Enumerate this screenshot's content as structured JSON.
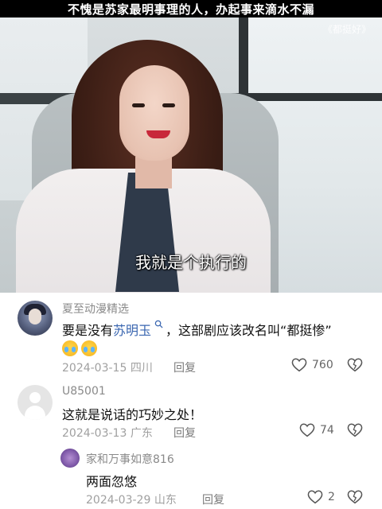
{
  "header": {
    "title": "不愧是苏家最明事理的人，办起事来滴水不漏"
  },
  "video": {
    "watermark": "《都挺好》",
    "subtitle": "我就是个执行的"
  },
  "comments": [
    {
      "username": "夏至动漫精选",
      "text_before": "要是没有",
      "link": "苏明玉",
      "text_after": "，这部剧应该改名叫“都挺惨”",
      "date": "2024-03-15",
      "location": "四川",
      "reply": "回复",
      "likes": "760"
    },
    {
      "username": "U85001",
      "text": "这就是说话的巧妙之处！",
      "date": "2024-03-13",
      "location": "广东",
      "reply": "回复",
      "likes": "74"
    },
    {
      "username": "家和万事如意816",
      "text": "两面忽悠",
      "date": "2024-03-29",
      "location": "山东",
      "reply": "回复",
      "likes": "2"
    }
  ],
  "icons": {
    "like": "heart-icon",
    "dislike": "dislike-heart-icon",
    "search": "search-icon",
    "emoji": "crying-laughing-emoji"
  }
}
